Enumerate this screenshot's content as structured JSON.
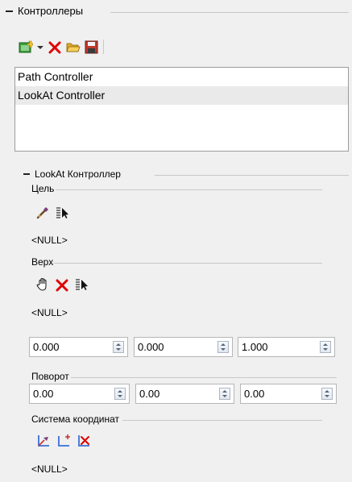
{
  "controllers": {
    "title": "Контроллеры",
    "toolbar": {
      "add_icon": "add-controller-icon",
      "dropdown_icon": "dropdown-arrow-icon",
      "delete_icon": "delete-icon",
      "open_icon": "open-folder-icon",
      "save_icon": "save-disk-icon"
    },
    "list": [
      {
        "label": "Path Controller",
        "selected": false
      },
      {
        "label": "LookAt Controller",
        "selected": true
      }
    ]
  },
  "lookat": {
    "title": "LookAt Контроллер",
    "target": {
      "title": "Цель",
      "value": "<NULL>",
      "icons": [
        "pick-eyedropper-icon",
        "select-from-list-icon"
      ]
    },
    "up": {
      "title": "Верх",
      "value": "<NULL>",
      "icons": [
        "hand-pick-icon",
        "clear-icon",
        "select-from-list-icon"
      ],
      "vector": [
        "0.000",
        "0.000",
        "1.000"
      ]
    },
    "rotation": {
      "title": "Поворот",
      "values": [
        "0.00",
        "0.00",
        "0.00"
      ]
    },
    "coord_system": {
      "title": "Система координат",
      "value": "<NULL>",
      "icons": [
        "axes-pick-icon",
        "axes-add-icon",
        "axes-clear-icon"
      ]
    }
  },
  "colors": {
    "red": "#e00000",
    "green": "#3aa03a",
    "folder": "#f2c14e"
  }
}
